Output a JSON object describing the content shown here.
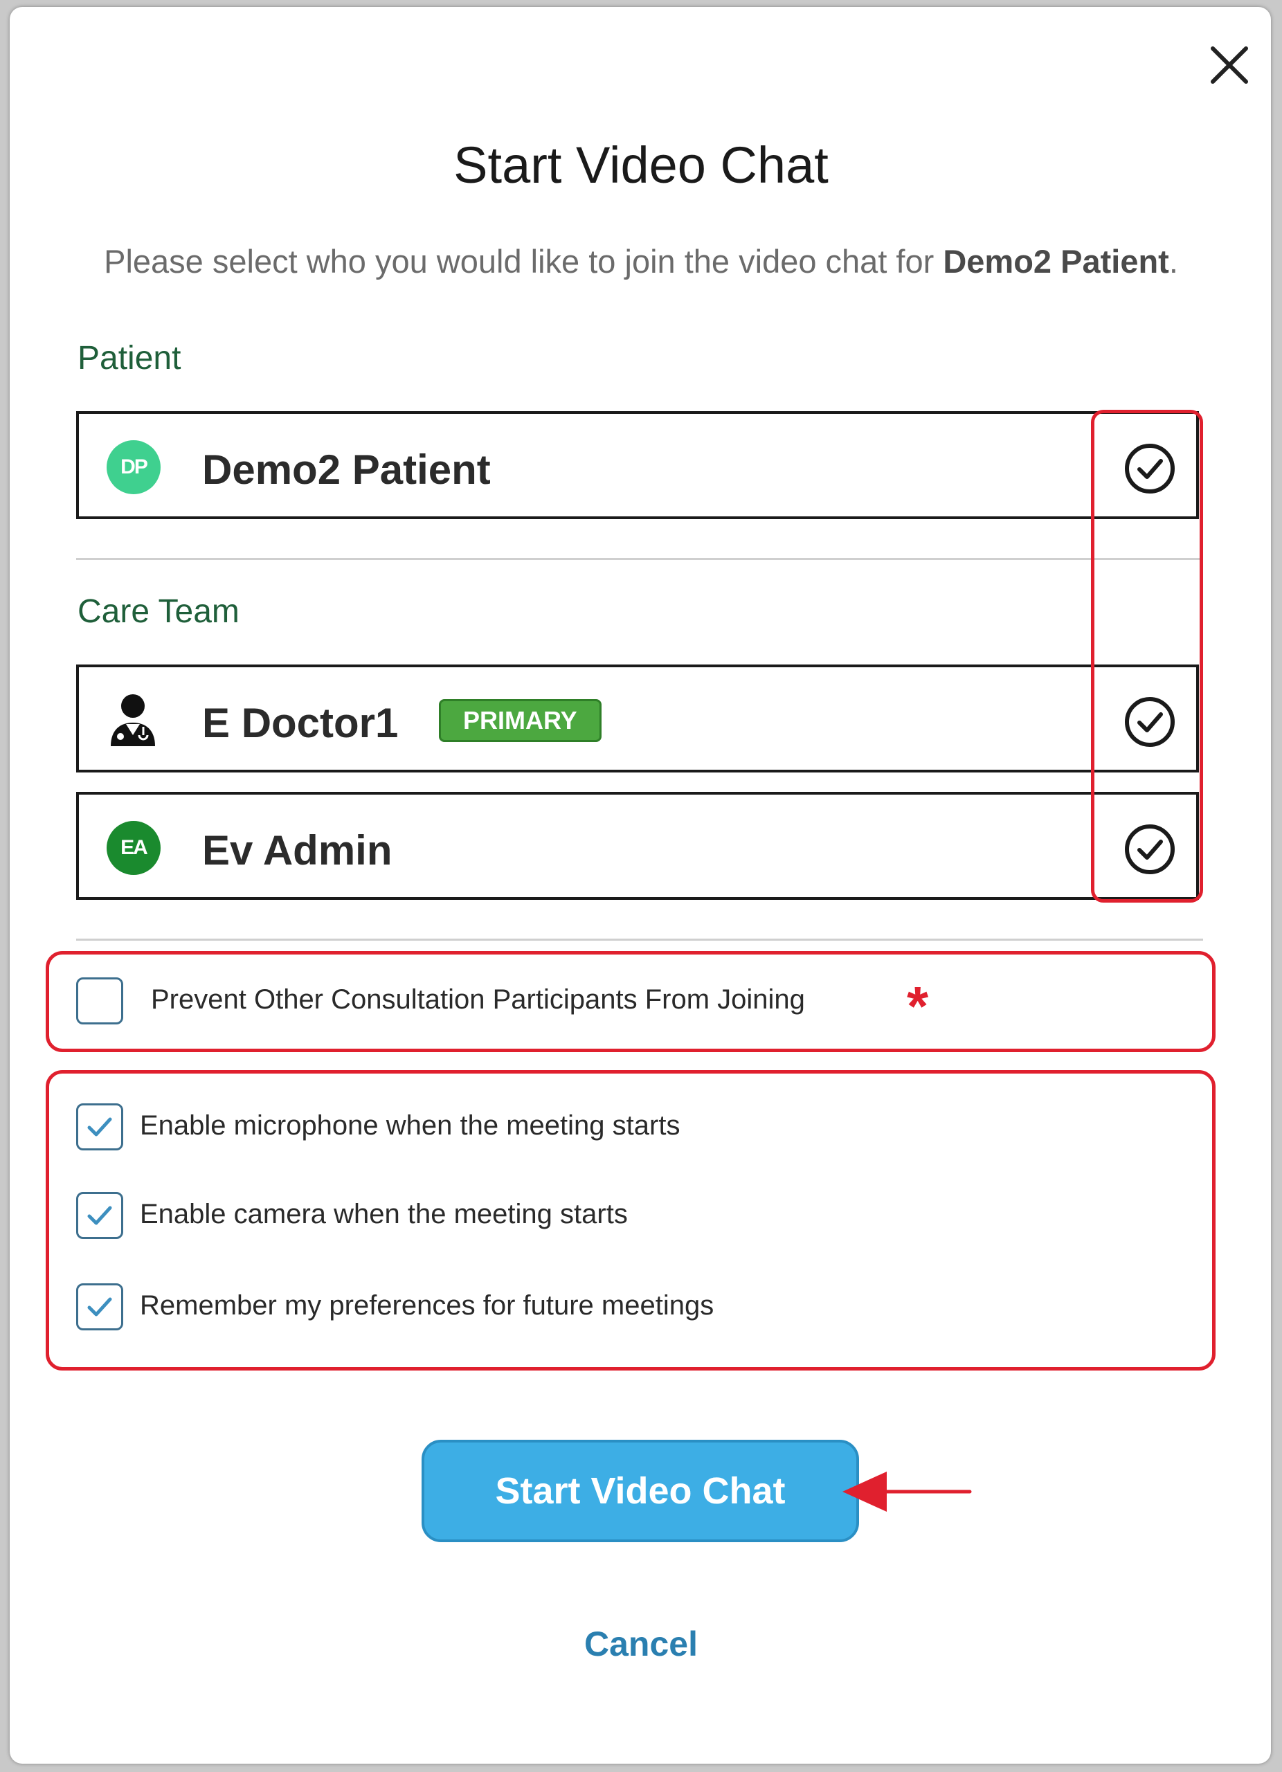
{
  "dialog": {
    "title": "Start Video Chat",
    "subtitle_prefix": "Please select who you would like to join the video chat for ",
    "subtitle_patient": "Demo2 Patient",
    "subtitle_suffix": "."
  },
  "patient_section": {
    "label": "Patient",
    "participants": [
      {
        "initials": "DP",
        "name": "Demo2 Patient",
        "selected": true,
        "icon": "check-circle-icon"
      }
    ]
  },
  "care_team_section": {
    "label": "Care Team",
    "participants": [
      {
        "name": "E Doctor1",
        "badge": "PRIMARY",
        "icon": "doctor-icon",
        "selected": true
      },
      {
        "initials": "EA",
        "name": "Ev Admin",
        "selected": true
      }
    ]
  },
  "options": {
    "prevent_joining": {
      "label": "Prevent Other Consultation Participants From Joining",
      "checked": false
    },
    "enable_microphone": {
      "label": "Enable microphone when the meeting starts",
      "checked": true
    },
    "enable_camera": {
      "label": "Enable camera when the meeting starts",
      "checked": true
    },
    "remember_preferences": {
      "label": "Remember my preferences for future meetings",
      "checked": true
    }
  },
  "annotations": {
    "asterisk": "*",
    "highlight_color": "#e0202e"
  },
  "actions": {
    "start_label": "Start Video Chat",
    "cancel_label": "Cancel"
  },
  "colors": {
    "accent": "#3daee5",
    "section_label": "#1f5f3a",
    "badge": "#4ca840"
  }
}
